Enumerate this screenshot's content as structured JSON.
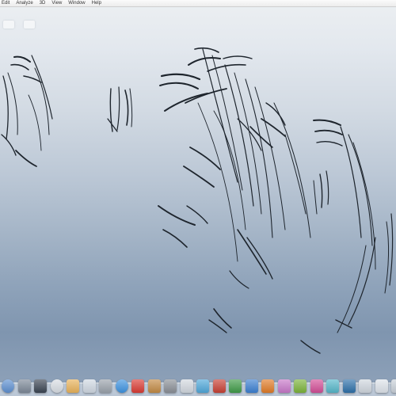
{
  "menubar": {
    "items": [
      "Edit",
      "Analyze",
      "3D",
      "View",
      "Window",
      "Help"
    ]
  },
  "desktop": {
    "icons": [
      "document-icon",
      "document-icon"
    ]
  },
  "dock": {
    "icons": [
      {
        "name": "finder-icon",
        "color": "#5d8fd0"
      },
      {
        "name": "dashboard-icon",
        "color": "#7c8897"
      },
      {
        "name": "mission-control-icon",
        "color": "#3a4452"
      },
      {
        "name": "safari-icon",
        "color": "#d8dde3"
      },
      {
        "name": "folder-icon",
        "color": "#e8b25a"
      },
      {
        "name": "mail-icon",
        "color": "#cfd8e2"
      },
      {
        "name": "system-preferences-icon",
        "color": "#9aa2ab"
      },
      {
        "name": "app-store-icon",
        "color": "#3d92e0"
      },
      {
        "name": "calendar-icon",
        "color": "#d93b34"
      },
      {
        "name": "contacts-icon",
        "color": "#c28a44"
      },
      {
        "name": "settings-icon",
        "color": "#8a8f96"
      },
      {
        "name": "preview-icon",
        "color": "#d2d8df"
      },
      {
        "name": "maps-icon",
        "color": "#4fa7d9"
      },
      {
        "name": "photo-booth-icon",
        "color": "#c74034"
      },
      {
        "name": "excel-icon",
        "color": "#3f9a47"
      },
      {
        "name": "word-icon",
        "color": "#3b7fd1"
      },
      {
        "name": "powerpoint-icon",
        "color": "#e07b27"
      },
      {
        "name": "itunes-icon",
        "color": "#c777c8"
      },
      {
        "name": "green-app-icon",
        "color": "#7bb33a"
      },
      {
        "name": "pink-app-icon",
        "color": "#d24e96"
      },
      {
        "name": "teal-app-icon",
        "color": "#55b6c9"
      },
      {
        "name": "photoshop-icon",
        "color": "#2d6fa8"
      },
      {
        "name": "downloads-stack-icon",
        "color": "#cfd6de"
      },
      {
        "name": "documents-stack-icon",
        "color": "#dde3ea"
      },
      {
        "name": "trash-icon",
        "color": "#c9d0d8"
      }
    ]
  }
}
